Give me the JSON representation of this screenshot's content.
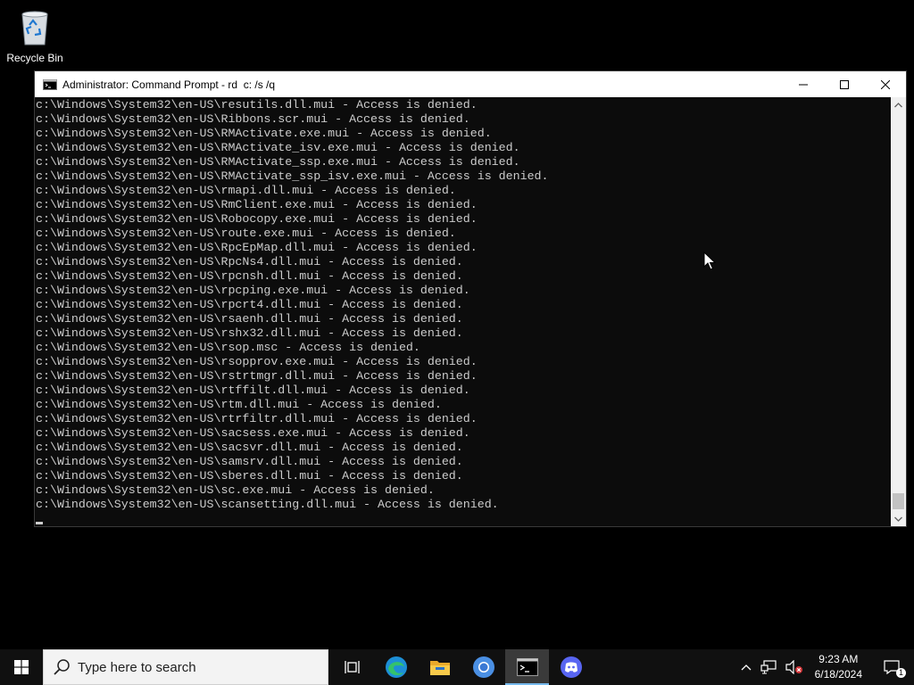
{
  "desktop": {
    "recycle_bin_label": "Recycle Bin"
  },
  "window": {
    "title": "Administrator: Command Prompt - rd  c: /s /q",
    "icon": "cmd-icon"
  },
  "console": {
    "lines": [
      "c:\\Windows\\System32\\en-US\\resutils.dll.mui - Access is denied.",
      "c:\\Windows\\System32\\en-US\\Ribbons.scr.mui - Access is denied.",
      "c:\\Windows\\System32\\en-US\\RMActivate.exe.mui - Access is denied.",
      "c:\\Windows\\System32\\en-US\\RMActivate_isv.exe.mui - Access is denied.",
      "c:\\Windows\\System32\\en-US\\RMActivate_ssp.exe.mui - Access is denied.",
      "c:\\Windows\\System32\\en-US\\RMActivate_ssp_isv.exe.mui - Access is denied.",
      "c:\\Windows\\System32\\en-US\\rmapi.dll.mui - Access is denied.",
      "c:\\Windows\\System32\\en-US\\RmClient.exe.mui - Access is denied.",
      "c:\\Windows\\System32\\en-US\\Robocopy.exe.mui - Access is denied.",
      "c:\\Windows\\System32\\en-US\\route.exe.mui - Access is denied.",
      "c:\\Windows\\System32\\en-US\\RpcEpMap.dll.mui - Access is denied.",
      "c:\\Windows\\System32\\en-US\\RpcNs4.dll.mui - Access is denied.",
      "c:\\Windows\\System32\\en-US\\rpcnsh.dll.mui - Access is denied.",
      "c:\\Windows\\System32\\en-US\\rpcping.exe.mui - Access is denied.",
      "c:\\Windows\\System32\\en-US\\rpcrt4.dll.mui - Access is denied.",
      "c:\\Windows\\System32\\en-US\\rsaenh.dll.mui - Access is denied.",
      "c:\\Windows\\System32\\en-US\\rshx32.dll.mui - Access is denied.",
      "c:\\Windows\\System32\\en-US\\rsop.msc - Access is denied.",
      "c:\\Windows\\System32\\en-US\\rsopprov.exe.mui - Access is denied.",
      "c:\\Windows\\System32\\en-US\\rstrtmgr.dll.mui - Access is denied.",
      "c:\\Windows\\System32\\en-US\\rtffilt.dll.mui - Access is denied.",
      "c:\\Windows\\System32\\en-US\\rtm.dll.mui - Access is denied.",
      "c:\\Windows\\System32\\en-US\\rtrfiltr.dll.mui - Access is denied.",
      "c:\\Windows\\System32\\en-US\\sacsess.exe.mui - Access is denied.",
      "c:\\Windows\\System32\\en-US\\sacsvr.dll.mui - Access is denied.",
      "c:\\Windows\\System32\\en-US\\samsrv.dll.mui - Access is denied.",
      "c:\\Windows\\System32\\en-US\\sberes.dll.mui - Access is denied.",
      "c:\\Windows\\System32\\en-US\\sc.exe.mui - Access is denied.",
      "c:\\Windows\\System32\\en-US\\scansetting.dll.mui - Access is denied."
    ]
  },
  "taskbar": {
    "search_placeholder": "Type here to search",
    "apps": [
      "task-view-icon",
      "edge-icon",
      "file-explorer-icon",
      "chrome-icon",
      "command-prompt-icon",
      "discord-icon"
    ],
    "clock_time": "9:23 AM",
    "clock_date": "6/18/2024",
    "notification_count": "1"
  },
  "colors": {
    "console_bg": "#0c0c0c",
    "console_text": "#cccccc",
    "taskbar_bg": "#101010",
    "accent": "#76b9ed"
  }
}
